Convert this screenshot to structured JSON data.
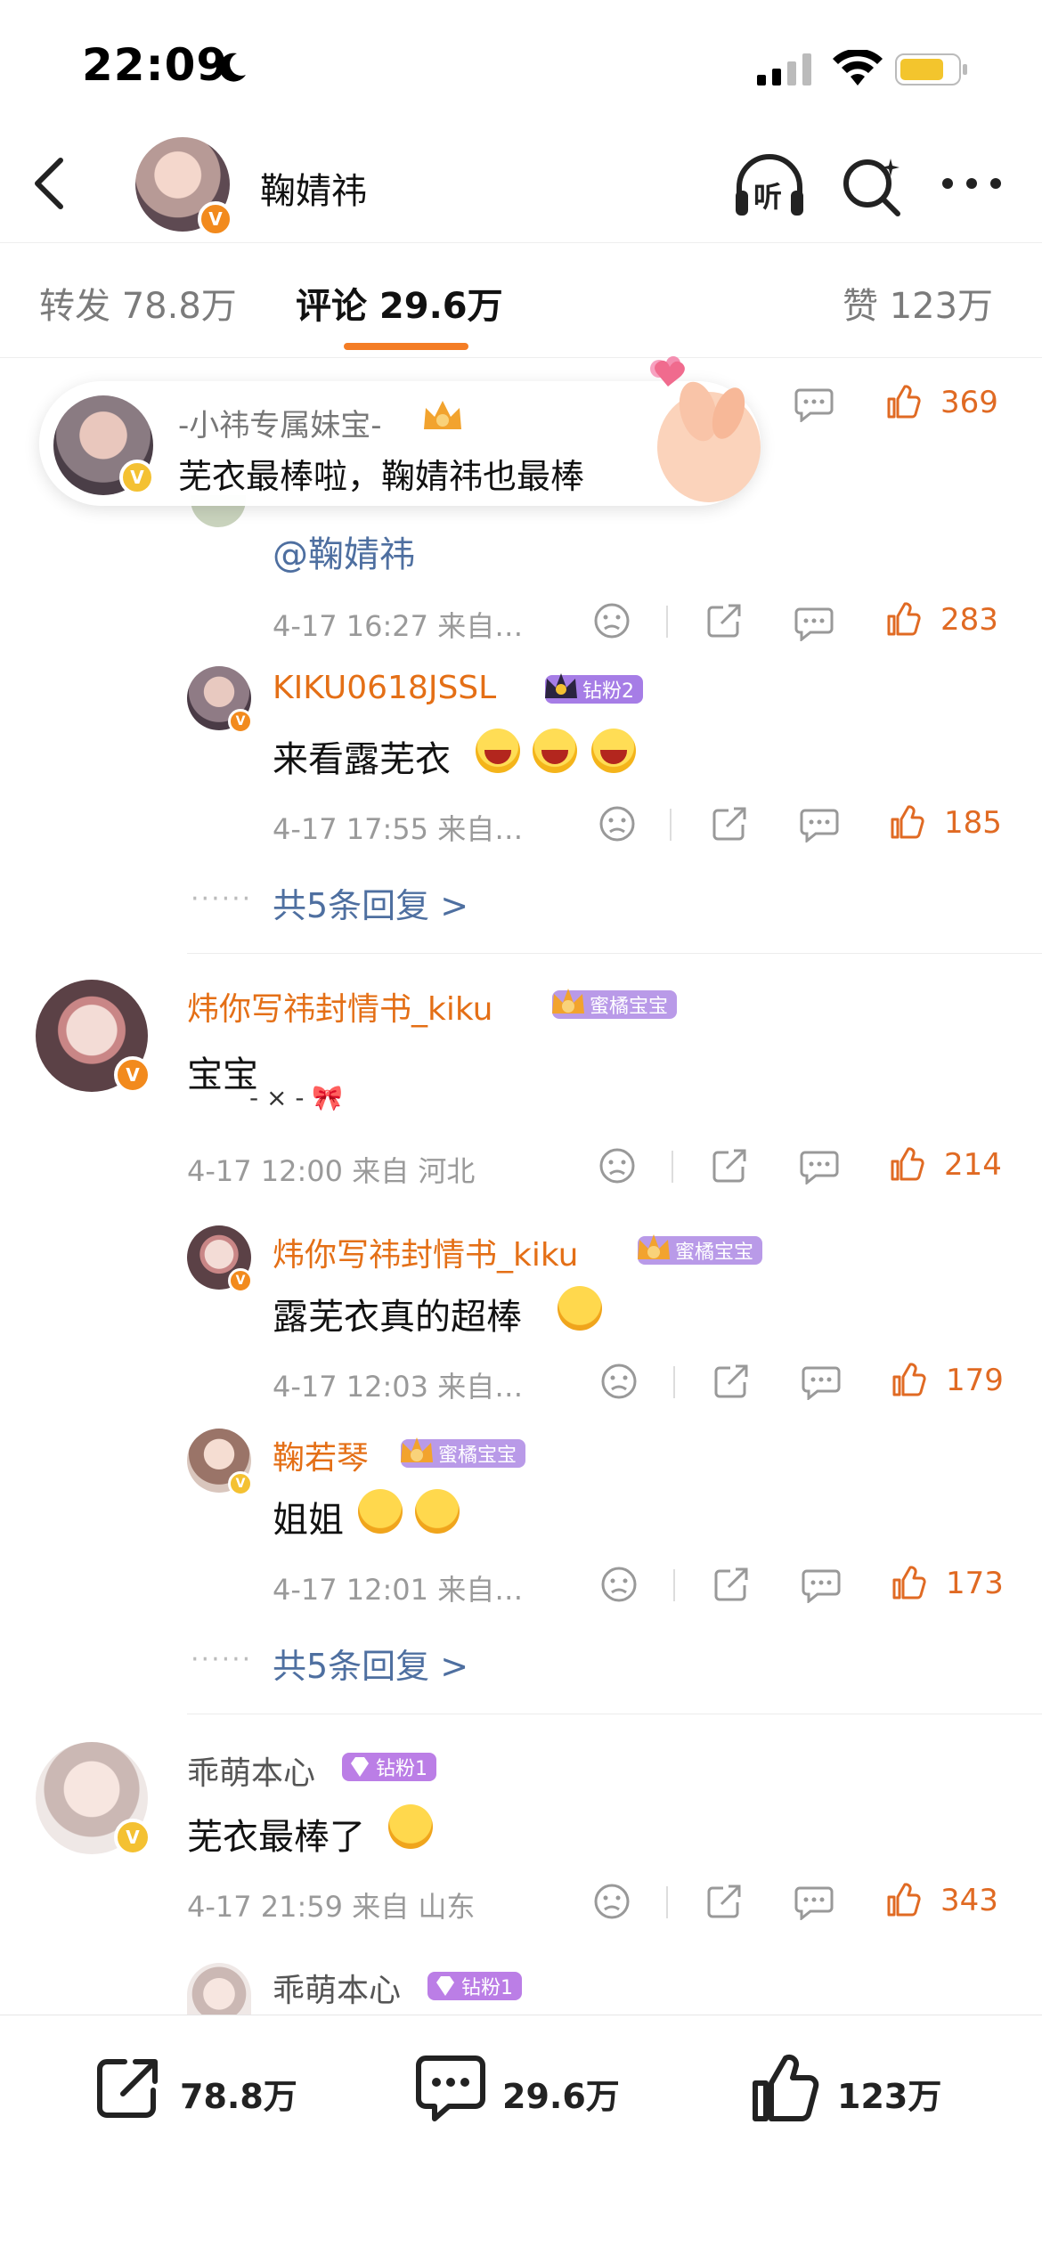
{
  "status_bar": {
    "time": "22:09"
  },
  "header": {
    "name": "鞠婧祎",
    "listen_label": "听"
  },
  "tabs": {
    "repost": "转发 78.8万",
    "comments": "评论 29.6万",
    "likes": "赞 123万"
  },
  "floating_card": {
    "title": "-小祎专属妹宝-",
    "text": "芜衣最棒啦，鞠婧祎也最棒"
  },
  "thread1": {
    "top_like_count": "369",
    "mention": "@鞠婧祎",
    "reply1_time": "4-17 16:27  来自…",
    "reply1_likes": "283",
    "reply2": {
      "name": "KIKU0618JSSL",
      "badge": "钻粉2",
      "text": "来看露芜衣",
      "time": "4-17 17:55  来自…",
      "likes": "185"
    },
    "more_dots": "······",
    "more_replies": "共5条回复 >"
  },
  "comment2": {
    "name": "炜你写祎封情书_kiku",
    "badge": "蜜橘宝宝",
    "text": "宝宝",
    "deco": "- × - 🎀",
    "time": "4-17 12:00  来自 河北",
    "likes": "214",
    "replies": [
      {
        "name": "炜你写祎封情书_kiku",
        "badge": "蜜橘宝宝",
        "text": "露芜衣真的超棒",
        "time": "4-17 12:03  来自…",
        "likes": "179"
      },
      {
        "name": "鞠若琴",
        "badge": "蜜橘宝宝",
        "text": "姐姐",
        "time": "4-17 12:01  来自…",
        "likes": "173"
      }
    ],
    "more_dots": "······",
    "more_replies": "共5条回复 >"
  },
  "comment3": {
    "name": "乖萌本心",
    "badge": "钻粉1",
    "text": "芜衣最棒了",
    "time": "4-17 21:59  来自 山东",
    "likes": "343",
    "reply_name": "乖萌本心",
    "reply_badge": "钻粉1"
  },
  "bottom_bar": {
    "repost": "78.8万",
    "comment": "29.6万",
    "like": "123万"
  },
  "colors": {
    "accent": "#f47d25",
    "name_orange": "#e46f16",
    "link_blue": "#4e6fa0",
    "like_orange": "#e06a23"
  }
}
